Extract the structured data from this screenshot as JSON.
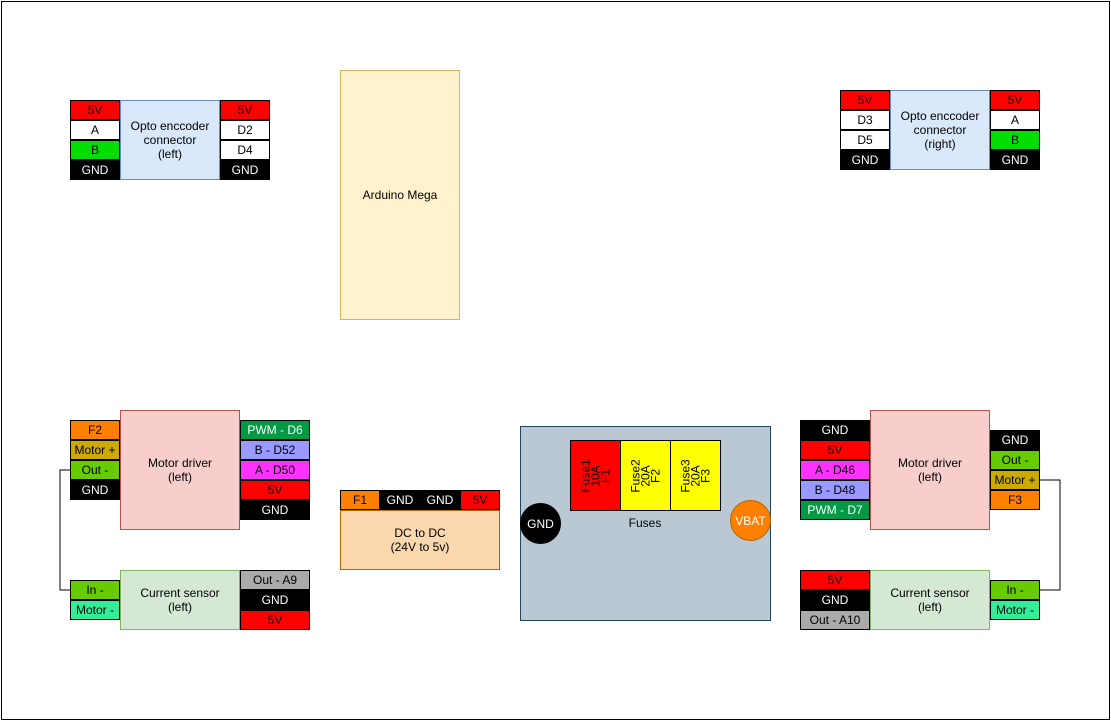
{
  "colors": {
    "red": "#ff0000",
    "white": "#ffffff",
    "green": "#00dd00",
    "black": "#000000",
    "orange": "#ff8000",
    "lime": "#66cc00",
    "gold": "#ccaa00",
    "pwm_green": "#009a44",
    "blue": "#9999ff",
    "magenta": "#ff33ff",
    "teal": "#33ee99",
    "gray": "#aaaaaa",
    "yellow": "#ffff00",
    "light_blue": "#dae8fc",
    "light_red": "#f8cecc",
    "light_green": "#d5e8d4",
    "light_yellow": "#fff2cc",
    "peach": "#fad7ac",
    "slate": "#bac8d3"
  },
  "opto_left": {
    "label": "Opto enccoder\nconnector\n(left)",
    "left_pins": [
      "5V",
      "A",
      "B",
      "GND"
    ],
    "right_pins": [
      "5V",
      "D2",
      "D4",
      "GND"
    ]
  },
  "opto_right": {
    "label": "Opto enccoder\nconnector\n(right)",
    "left_pins": [
      "5V",
      "D3",
      "D5",
      "GND"
    ],
    "right_pins": [
      "5V",
      "A",
      "B",
      "GND"
    ]
  },
  "arduino": {
    "label": "Arduino Mega"
  },
  "motor_driver_left": {
    "label": "Motor driver\n(left)",
    "left_pins": [
      "F2",
      "Motor +",
      "Out -",
      "GND"
    ],
    "right_pins": [
      "PWM - D6",
      "B - D52",
      "A - D50",
      "5V",
      "GND"
    ]
  },
  "current_sensor_left": {
    "label": "Current sensor\n(left)",
    "left_pins": [
      "In -",
      "Motor -"
    ],
    "right_pins": [
      "Out - A9",
      "GND",
      "5V"
    ]
  },
  "dc_dc": {
    "label": "DC to DC\n(24V to 5v)",
    "pins": [
      "F1",
      "GND",
      "GND",
      "5V"
    ]
  },
  "fuses": {
    "label": "Fuses",
    "items": [
      "Fuse1\n10A\nF1",
      "Fuse2\n20A\nF2",
      "Fuse3\n20A\nF3"
    ],
    "gnd": "GND",
    "vbat": "VBAT"
  },
  "motor_driver_right": {
    "label": "Motor driver\n(left)",
    "left_pins": [
      "GND",
      "5V",
      "A - D46",
      "B - D48",
      "PWM - D7"
    ],
    "right_pins": [
      "GND",
      "Out -",
      "Motor +",
      "F3"
    ]
  },
  "current_sensor_right": {
    "label": "Current sensor\n(left)",
    "left_pins": [
      "5V",
      "GND",
      "Out - A10"
    ],
    "right_pins": [
      "In -",
      "Motor -"
    ]
  }
}
